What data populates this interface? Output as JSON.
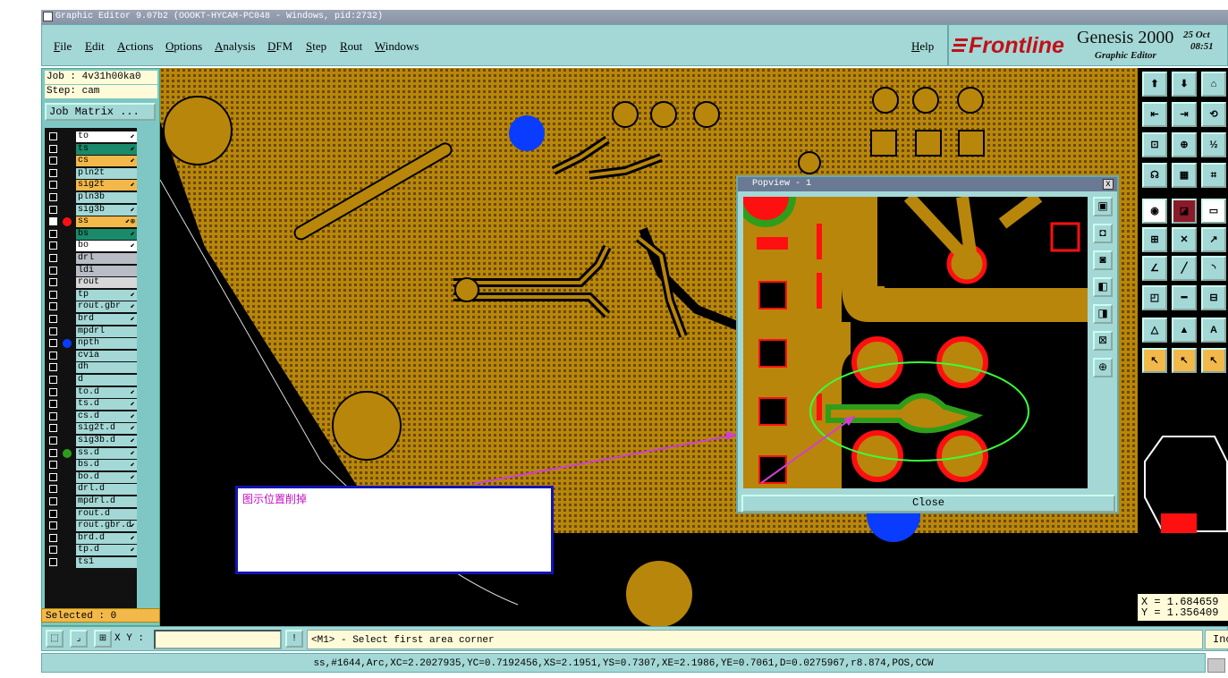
{
  "window": {
    "title": "Graphic Editor 9.07b2 (OOOKT-HYCAM-PC048 - Windows, pid:2732)"
  },
  "menu": {
    "items": [
      {
        "label": "File"
      },
      {
        "label": "Edit"
      },
      {
        "label": "Actions"
      },
      {
        "label": "Options"
      },
      {
        "label": "Analysis"
      },
      {
        "label": "DFM"
      },
      {
        "label": "Step"
      },
      {
        "label": "Rout"
      },
      {
        "label": "Windows"
      }
    ],
    "help": "Help"
  },
  "brand": {
    "logo": "Frontline",
    "product": "Genesis 2000",
    "subtitle": "Graphic Editor",
    "date": "25 Oct",
    "time": "08:51"
  },
  "job": {
    "job_line": "Job : 4v31h00ka0",
    "step_line": "Step: cam",
    "matrix_button": "Job Matrix ..."
  },
  "layers": [
    {
      "name": "to",
      "color": "#ffffff",
      "arrow": "⬋"
    },
    {
      "name": "ts",
      "color": "#1a8a6a",
      "arrow": "⬋"
    },
    {
      "name": "cs",
      "color": "#f2b84a",
      "arrow": "⬋"
    },
    {
      "name": "pln2t",
      "color": "#a3d8d6",
      "arrow": ""
    },
    {
      "name": "sig2t",
      "color": "#f2b84a",
      "arrow": "⬋"
    },
    {
      "name": "pln3b",
      "color": "#a3d8d6",
      "arrow": ""
    },
    {
      "name": "sig3b",
      "color": "#a3d8d6",
      "arrow": "⬋"
    },
    {
      "name": "ss",
      "color": "#f2b84a",
      "arrow": "⬋⊕"
    },
    {
      "name": "bs",
      "color": "#1a8a6a",
      "arrow": "⬋"
    },
    {
      "name": "bo",
      "color": "#ffffff",
      "arrow": "⬋"
    },
    {
      "name": "drl",
      "color": "#b8bcc4",
      "arrow": ""
    },
    {
      "name": "ldi",
      "color": "#b8bcc4",
      "arrow": ""
    },
    {
      "name": "rout",
      "color": "#d8d8d8",
      "arrow": ""
    },
    {
      "name": "tp",
      "color": "#a3d8d6",
      "arrow": "⬋"
    },
    {
      "name": "rout.gbr",
      "color": "#a3d8d6",
      "arrow": "⬋"
    },
    {
      "name": "brd",
      "color": "#a3d8d6",
      "arrow": "⬋"
    },
    {
      "name": "mpdrl",
      "color": "#a3d8d6",
      "arrow": ""
    },
    {
      "name": "npth",
      "color": "#a3d8d6",
      "arrow": ""
    },
    {
      "name": "cvia",
      "color": "#a3d8d6",
      "arrow": ""
    },
    {
      "name": "dh",
      "color": "#a3d8d6",
      "arrow": ""
    },
    {
      "name": "d",
      "color": "#a3d8d6",
      "arrow": ""
    },
    {
      "name": "to.d",
      "color": "#a3d8d6",
      "arrow": "⬋"
    },
    {
      "name": "ts.d",
      "color": "#a3d8d6",
      "arrow": "⬋"
    },
    {
      "name": "cs.d",
      "color": "#a3d8d6",
      "arrow": "⬋"
    },
    {
      "name": "sig2t.d",
      "color": "#a3d8d6",
      "arrow": "⬋"
    },
    {
      "name": "sig3b.d",
      "color": "#a3d8d6",
      "arrow": "⬋"
    },
    {
      "name": "ss.d",
      "color": "#a3d8d6",
      "arrow": "⬋"
    },
    {
      "name": "bs.d",
      "color": "#a3d8d6",
      "arrow": "⬋"
    },
    {
      "name": "bo.d",
      "color": "#a3d8d6",
      "arrow": "⬋"
    },
    {
      "name": "drl.d",
      "color": "#a3d8d6",
      "arrow": ""
    },
    {
      "name": "mpdrl.d",
      "color": "#a3d8d6",
      "arrow": ""
    },
    {
      "name": "rout.d",
      "color": "#a3d8d6",
      "arrow": ""
    },
    {
      "name": "rout.gbr.d",
      "color": "#a3d8d6",
      "arrow": "⬋"
    },
    {
      "name": "brd.d",
      "color": "#a3d8d6",
      "arrow": "⬋"
    },
    {
      "name": "tp.d",
      "color": "#a3d8d6",
      "arrow": "⬋"
    },
    {
      "name": "ts1",
      "color": "#a3d8d6",
      "arrow": ""
    }
  ],
  "selected": "Selected : 0",
  "popview": {
    "title": "Popview - 1",
    "close_label": "Close",
    "close_icon": "x"
  },
  "note": {
    "text": "图示位置削掉"
  },
  "coords": {
    "x": "X = 1.684659",
    "y": "Y = 1.356409"
  },
  "command": {
    "xy_label": "X Y :",
    "xy_value": "",
    "prompt": "<M1> - Select first area corner",
    "inc_label": "Inc"
  },
  "status": {
    "text": "ss,#1644,Arc,XC=2.2027935,YC=0.7192456,XS=2.1951,YS=0.7307,XE=2.1986,YE=0.7061,D=0.0275967,r8.874,POS,CCW"
  },
  "colors": {
    "copper": "#b8860b",
    "pad_red": "#ff1010",
    "mask_green": "#2e9e1a",
    "highlight_green": "#3aff3a",
    "blue_via": "#0a3cff",
    "panel_teal": "#a3d8d6"
  }
}
